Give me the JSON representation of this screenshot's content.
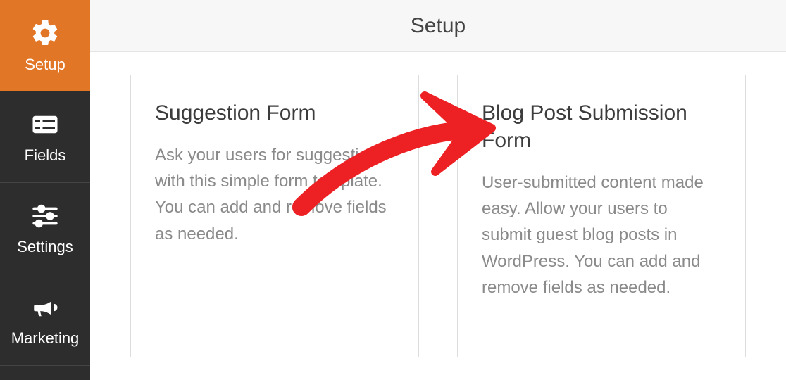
{
  "sidebar": {
    "items": [
      {
        "label": "Setup",
        "active": true
      },
      {
        "label": "Fields",
        "active": false
      },
      {
        "label": "Settings",
        "active": false
      },
      {
        "label": "Marketing",
        "active": false
      }
    ]
  },
  "header": {
    "title": "Setup"
  },
  "cards": [
    {
      "title": "Suggestion Form",
      "desc": "Ask your users for suggestions with this simple form template. You can add and remove fields as needed."
    },
    {
      "title": "Blog Post Submission Form",
      "desc": "User-submitted content made easy. Allow your users to submit guest blog posts in WordPress. You can add and remove fields as needed."
    }
  ],
  "colors": {
    "accent": "#e27627",
    "sidebar_bg": "#2d2d2d",
    "arrow": "#ed2024"
  }
}
